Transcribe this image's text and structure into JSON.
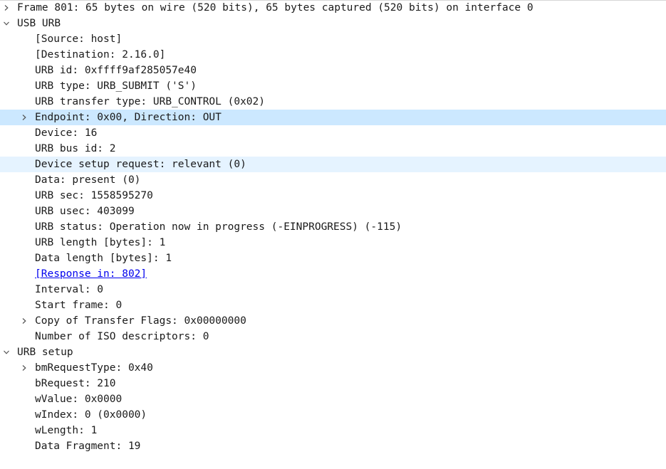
{
  "tree": {
    "rows": [
      {
        "text": "Frame 801: 65 bytes on wire (520 bits), 65 bytes captured (520 bits) on interface 0",
        "level": 0,
        "toggle": "collapsed"
      },
      {
        "text": "USB URB",
        "level": 0,
        "toggle": "expanded"
      },
      {
        "text": "[Source: host]",
        "level": 1,
        "toggle": "none"
      },
      {
        "text": "[Destination: 2.16.0]",
        "level": 1,
        "toggle": "none"
      },
      {
        "text": "URB id: 0xffff9af285057e40",
        "level": 1,
        "toggle": "none"
      },
      {
        "text": "URB type: URB_SUBMIT ('S')",
        "level": 1,
        "toggle": "none"
      },
      {
        "text": "URB transfer type: URB_CONTROL (0x02)",
        "level": 1,
        "toggle": "none"
      },
      {
        "text": "Endpoint: 0x00, Direction: OUT",
        "level": 1,
        "toggle": "collapsed",
        "state": "selected"
      },
      {
        "text": "Device: 16",
        "level": 1,
        "toggle": "none"
      },
      {
        "text": "URB bus id: 2",
        "level": 1,
        "toggle": "none"
      },
      {
        "text": "Device setup request: relevant (0)",
        "level": 1,
        "toggle": "none",
        "state": "hover"
      },
      {
        "text": "Data: present (0)",
        "level": 1,
        "toggle": "none"
      },
      {
        "text": "URB sec: 1558595270",
        "level": 1,
        "toggle": "none"
      },
      {
        "text": "URB usec: 403099",
        "level": 1,
        "toggle": "none"
      },
      {
        "text": "URB status: Operation now in progress (-EINPROGRESS) (-115)",
        "level": 1,
        "toggle": "none"
      },
      {
        "text": "URB length [bytes]: 1",
        "level": 1,
        "toggle": "none"
      },
      {
        "text": "Data length [bytes]: 1",
        "level": 1,
        "toggle": "none"
      },
      {
        "text": "[Response in: 802]",
        "level": 1,
        "toggle": "none",
        "link": true
      },
      {
        "text": "Interval: 0",
        "level": 1,
        "toggle": "none"
      },
      {
        "text": "Start frame: 0",
        "level": 1,
        "toggle": "none"
      },
      {
        "text": "Copy of Transfer Flags: 0x00000000",
        "level": 1,
        "toggle": "collapsed"
      },
      {
        "text": "Number of ISO descriptors: 0",
        "level": 1,
        "toggle": "none"
      },
      {
        "text": "URB setup",
        "level": 0,
        "toggle": "expanded"
      },
      {
        "text": "bmRequestType: 0x40",
        "level": 1,
        "toggle": "collapsed"
      },
      {
        "text": "bRequest: 210",
        "level": 1,
        "toggle": "none"
      },
      {
        "text": "wValue: 0x0000",
        "level": 1,
        "toggle": "none"
      },
      {
        "text": "wIndex: 0 (0x0000)",
        "level": 1,
        "toggle": "none"
      },
      {
        "text": "wLength: 1",
        "level": 1,
        "toggle": "none"
      },
      {
        "text": "Data Fragment: 19",
        "level": 1,
        "toggle": "none"
      }
    ]
  },
  "colors": {
    "selected_row": "#cce8ff",
    "hover_row": "#e5f3ff",
    "link": "#0000ee",
    "text": "#1a1a1a"
  },
  "icons": {
    "collapsed": "chevron-right-icon",
    "expanded": "chevron-down-icon"
  }
}
